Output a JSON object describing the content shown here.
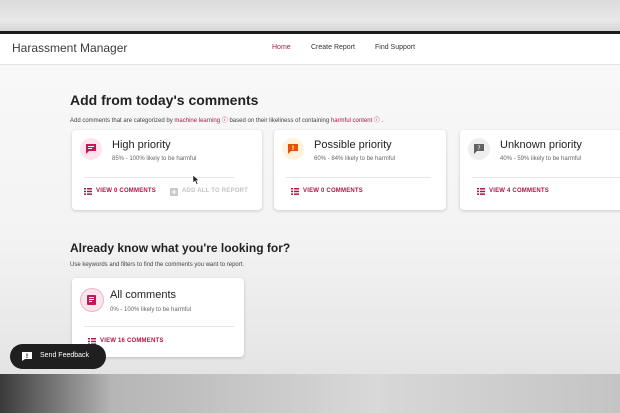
{
  "app": {
    "title": "Harassment Manager",
    "nav": [
      "Home",
      "Create Report",
      "Find Support"
    ],
    "accent": "#a8174a"
  },
  "section1": {
    "title": "Add from today's comments",
    "desc_prefix": "Add comments that are categorized by",
    "link1": "machine learning",
    "desc_mid": "based on their likeliness of containing",
    "link2": "harmful content",
    "desc_suffix": "."
  },
  "cards": [
    {
      "title": "High priority",
      "subtitle": "85% - 100% likely to be harmful",
      "icon": "comment-alert-icon",
      "icon_color": "#c2185b",
      "action": "VIEW 0 COMMENTS",
      "secondary_action": "ADD ALL TO REPORT"
    },
    {
      "title": "Possible priority",
      "subtitle": "60% - 84% likely to be harmful",
      "icon": "comment-warning-icon",
      "icon_color": "#e65100",
      "action": "VIEW 0 COMMENTS"
    },
    {
      "title": "Unknown priority",
      "subtitle": "40% - 59% likely to be harmful",
      "icon": "comment-question-icon",
      "icon_color": "#616161",
      "action": "VIEW 4 COMMENTS"
    }
  ],
  "section2": {
    "title": "Already know what you're looking for?",
    "desc": "Use keywords and filters to find the comments you want to report."
  },
  "all_comments": {
    "title": "All comments",
    "subtitle": "0% - 100% likely to be harmful",
    "action": "VIEW 16 COMMENTS",
    "icon": "all-comments-icon"
  },
  "feedback": {
    "label": "Send Feedback",
    "icon": "feedback-icon"
  }
}
